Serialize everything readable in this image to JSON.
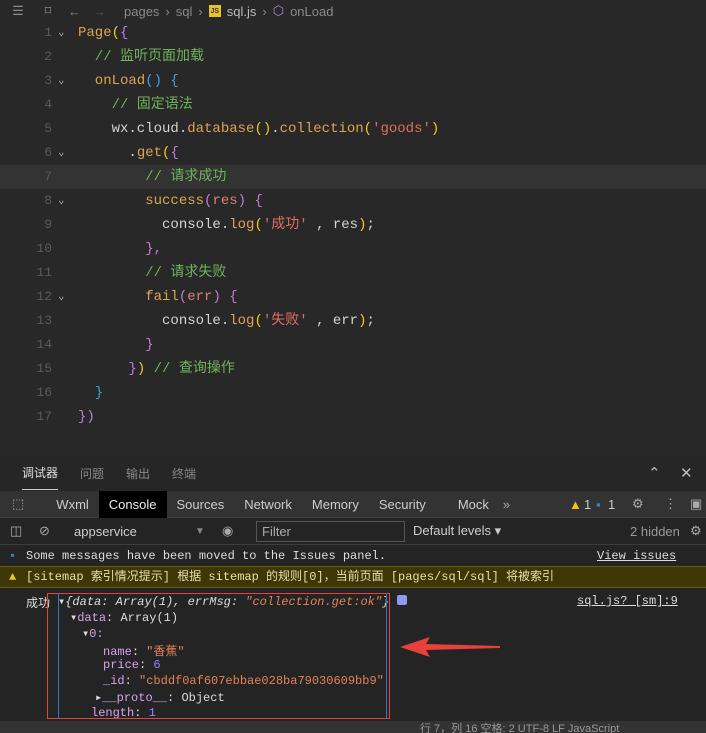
{
  "breadcrumb": {
    "items": [
      "pages",
      "sql",
      "sql.js",
      "onLoad"
    ],
    "icons": [
      "list-icon",
      "bookmark-icon",
      "back-arrow-icon",
      "forward-arrow-icon"
    ]
  },
  "editor": {
    "current_line": 7,
    "lines": [
      [
        [
          "Page",
          "t-fn"
        ],
        [
          "(",
          "t-y"
        ],
        [
          "{",
          "t-p"
        ]
      ],
      [
        [
          "  // 监听页面加载",
          "t-cm"
        ]
      ],
      [
        [
          "  onLoad",
          "t-fn"
        ],
        [
          "()",
          "t-b"
        ],
        [
          " {",
          "t-b"
        ]
      ],
      [
        [
          "    // 固定语法",
          "t-cm"
        ]
      ],
      [
        [
          "    wx.cloud.",
          "t-pl"
        ],
        [
          "database",
          "t-fn"
        ],
        [
          "()",
          "t-y"
        ],
        [
          ".",
          "t-pl"
        ],
        [
          "collection",
          "t-fn"
        ],
        [
          "(",
          "t-y"
        ],
        [
          "'goods'",
          "t-st"
        ],
        [
          ")",
          "t-y"
        ]
      ],
      [
        [
          "      .",
          "t-pl"
        ],
        [
          "get",
          "t-fn"
        ],
        [
          "(",
          "t-y"
        ],
        [
          "{",
          "t-p"
        ]
      ],
      [
        [
          "        // 请求成功",
          "t-cm"
        ]
      ],
      [
        [
          "        success",
          "t-fn"
        ],
        [
          "(",
          "t-p"
        ],
        [
          "res",
          "t-vr"
        ],
        [
          ")",
          "t-p"
        ],
        [
          " {",
          "t-p"
        ]
      ],
      [
        [
          "          console.",
          "t-pl"
        ],
        [
          "log",
          "t-fn"
        ],
        [
          "(",
          "t-y"
        ],
        [
          "'成功'",
          "t-st"
        ],
        [
          " , res",
          "t-pl"
        ],
        [
          ")",
          "t-y"
        ],
        [
          ";",
          "t-pl"
        ]
      ],
      [
        [
          "        },",
          "t-p"
        ]
      ],
      [
        [
          "        // 请求失败",
          "t-cm"
        ]
      ],
      [
        [
          "        fail",
          "t-fn"
        ],
        [
          "(",
          "t-p"
        ],
        [
          "err",
          "t-vr"
        ],
        [
          ")",
          "t-p"
        ],
        [
          " {",
          "t-p"
        ]
      ],
      [
        [
          "          console.",
          "t-pl"
        ],
        [
          "log",
          "t-fn"
        ],
        [
          "(",
          "t-y"
        ],
        [
          "'失败'",
          "t-st"
        ],
        [
          " , err",
          "t-pl"
        ],
        [
          ")",
          "t-y"
        ],
        [
          ";",
          "t-pl"
        ]
      ],
      [
        [
          "        }",
          "t-p"
        ]
      ],
      [
        [
          "      }",
          "t-p"
        ],
        [
          ")",
          "t-y"
        ],
        [
          " // 查询操作",
          "t-cm"
        ]
      ],
      [
        [
          "  }",
          "t-b"
        ]
      ],
      [
        [
          "})",
          "t-p"
        ]
      ]
    ],
    "folds": [
      1,
      3,
      6,
      8,
      12
    ]
  },
  "panel": {
    "tabs": [
      "调试器",
      "问题",
      "输出",
      "终端"
    ],
    "active_tab": "调试器"
  },
  "devtools": {
    "tabs": [
      "Wxml",
      "Console",
      "Sources",
      "Network",
      "Memory",
      "Security",
      "Mock"
    ],
    "active_tab": "Console",
    "more": "»",
    "warn_count": "1",
    "info_count": "1"
  },
  "console_toolbar": {
    "context": "appservice",
    "filter_placeholder": "Filter",
    "levels": "Default levels ▾",
    "hidden": "2 hidden"
  },
  "messages": {
    "issues": "Some messages have been moved to the Issues panel.",
    "view_issues": "View issues",
    "warning": "[sitemap 索引情况提示] 根据 sitemap 的规则[0]，当前页面 [pages/sql/sql] 将被索引"
  },
  "log": {
    "label": "成功",
    "source": "sql.js? [sm]:9",
    "summary_open": "{data: Array(1), errMsg: ",
    "summary_msg": "\"collection.get:ok\"",
    "summary_close": "}",
    "data_key": "data",
    "data_val": "Array(1)",
    "index": "0:",
    "name_key": "name",
    "name_val": "\"香蕉\"",
    "price_key": "price",
    "price_val": "6",
    "id_key": "_id",
    "id_val": "\"cbddf0af607ebbae028ba79030609bb9\"",
    "proto_key": "__proto__",
    "proto_val": "Object",
    "length_key": "length",
    "length_val": "1"
  },
  "annotation": {
    "color": "#e8403a"
  },
  "status": "行 7，列 16    空格: 2    UTF-8    LF    JavaScript"
}
